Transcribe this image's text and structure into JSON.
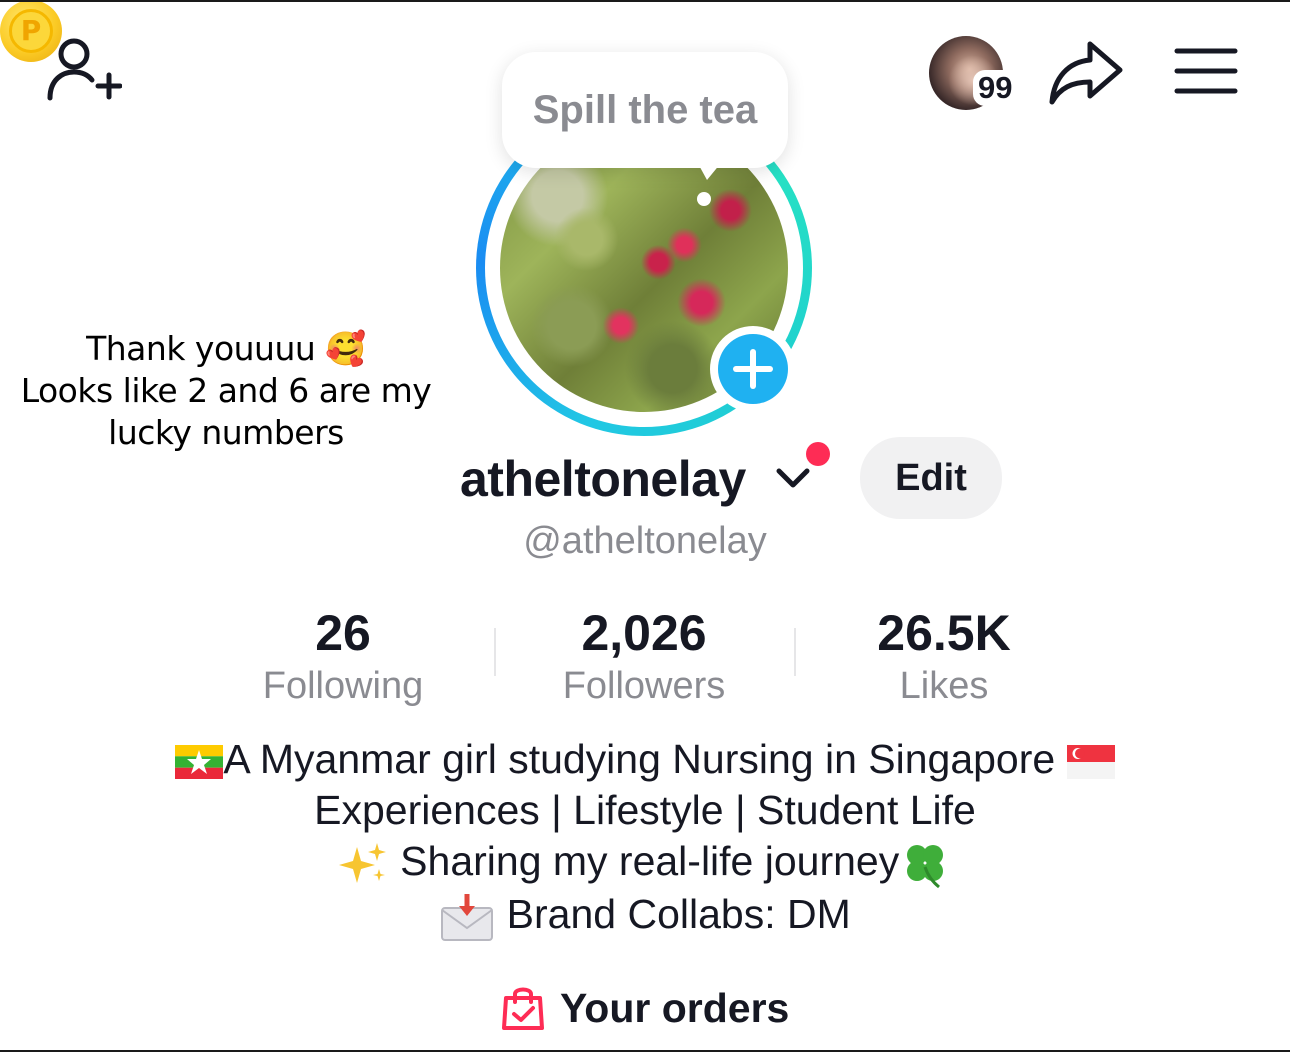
{
  "header": {
    "story_count": "99"
  },
  "tooltip": {
    "text": "Spill the tea"
  },
  "sticker": {
    "line1": "Thank youuuu 🥰",
    "line2": "Looks like 2 and 6 are my",
    "line3": "lucky numbers"
  },
  "profile": {
    "username": "atheltonelay",
    "handle": "@atheltonelay",
    "edit_label": "Edit"
  },
  "stats": {
    "following_value": "26",
    "following_label": "Following",
    "followers_value": "2,026",
    "followers_label": "Followers",
    "likes_value": "26.5K",
    "likes_label": "Likes"
  },
  "bio": {
    "line1": "A Myanmar girl studying Nursing in Singapore",
    "line2": "Experiences | Lifestyle | Student Life",
    "line3": "Sharing my real-life journey",
    "line4": "Brand Collabs: DM"
  },
  "orders": {
    "label": "Your orders"
  },
  "colors": {
    "accent_red": "#fe2c55",
    "story_blue": "#1fb1f1",
    "ring_cyan": "#21c7e4",
    "text_primary": "#161823",
    "text_secondary": "#8a8b91"
  },
  "icons": [
    "add-friend-icon",
    "coin-icon",
    "share-icon",
    "menu-icon",
    "chevron-down-icon",
    "plus-icon",
    "shopping-bag-icon",
    "myanmar-flag-icon",
    "singapore-flag-icon",
    "sparkles-icon",
    "four-leaf-clover-icon",
    "envelope-icon"
  ]
}
